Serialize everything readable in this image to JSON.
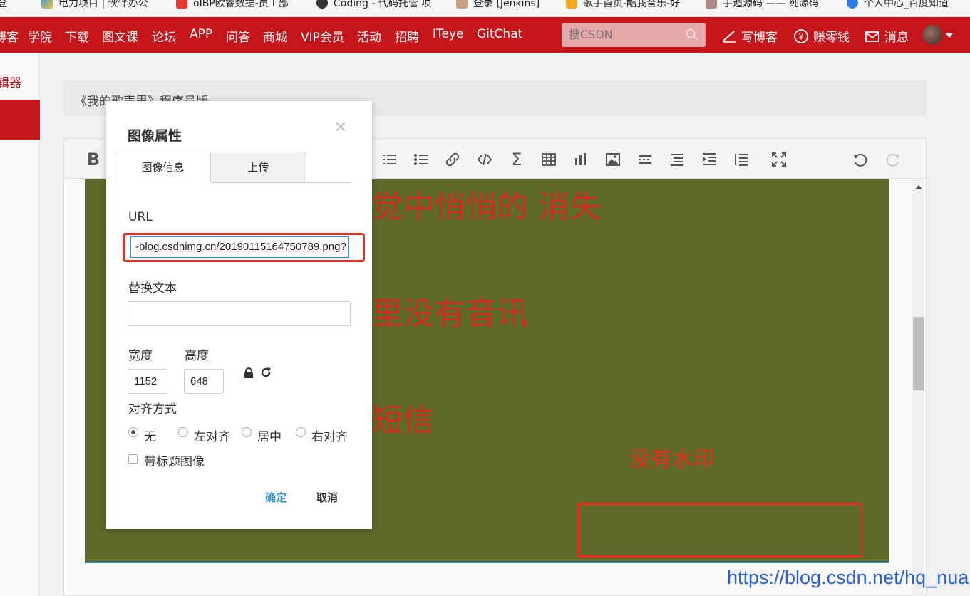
{
  "bookmarks": [
    {
      "label": "登",
      "icon": "bookmark-icon"
    },
    {
      "label": "电力项目 | 伙伴办公",
      "icon": "bookmark-icon"
    },
    {
      "label": "oIBP欧睿数据-员工部",
      "icon": "bookmark-icon"
    },
    {
      "label": "Coding - 代码托管 项",
      "icon": "bookmark-icon"
    },
    {
      "label": "登录 [Jenkins]",
      "icon": "bookmark-icon"
    },
    {
      "label": "歌手首页-酷我音乐-好",
      "icon": "bookmark-icon"
    },
    {
      "label": "手遁源码 —— 纯源码",
      "icon": "bookmark-icon"
    },
    {
      "label": "个人中心_百度知道",
      "icon": "bookmark-icon"
    }
  ],
  "nav": {
    "items": [
      "博客",
      "学院",
      "下载",
      "图文课",
      "论坛",
      "APP",
      "问答",
      "商城",
      "VIP会员",
      "活动",
      "招聘",
      "ITeye",
      "GitChat"
    ],
    "search_placeholder": "搜CSDN",
    "write_blog": "写博客",
    "earn_money": "赚零钱",
    "messages": "消息"
  },
  "sidebar": {
    "label": "辑器"
  },
  "editor": {
    "article_title": "《我的歌声里》程序员版",
    "toolbar_first": "B",
    "lyrics": [
      "觉中悄悄的 消失",
      "里没有音讯",
      "短信"
    ],
    "annotation": "没有水印",
    "watermark": "https://blog.csdn.net/hq_nuan"
  },
  "dialog": {
    "title": "图像属性",
    "close": "×",
    "tabs": [
      "图像信息",
      "上传"
    ],
    "url_label": "URL",
    "url_value": "-blog.csdnimg.cn/20190115164750789.png?",
    "alt_label": "替换文本",
    "alt_value": "",
    "width_label": "宽度",
    "height_label": "高度",
    "width_value": "1152",
    "height_value": "648",
    "align_label": "对齐方式",
    "align_options": [
      "无",
      "左对齐",
      "居中",
      "右对齐"
    ],
    "align_selected": "无",
    "caption_label": "带标题图像",
    "ok": "确定",
    "cancel": "取消"
  },
  "colors": {
    "nav_red": "#c5161c",
    "image_bg": "#5e6a28",
    "lyric_red": "#d02d22",
    "highlight_red": "#ee2a1f",
    "link_blue": "#2a5fd6"
  }
}
